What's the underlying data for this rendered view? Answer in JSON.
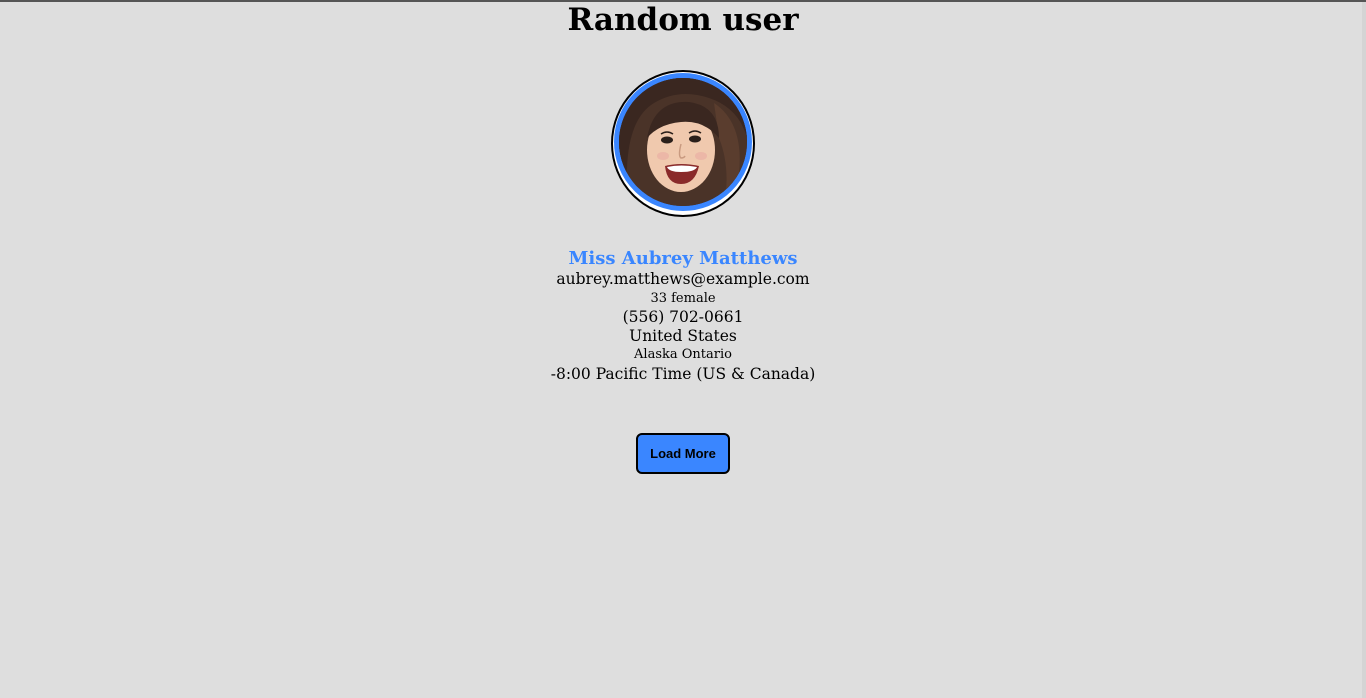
{
  "header": {
    "title": "Random user"
  },
  "user": {
    "name": "Miss Aubrey Matthews",
    "email": "aubrey.matthews@example.com",
    "age_gender": "33 female",
    "phone": "(556) 702-0661",
    "country": "United States",
    "region": "Alaska Ontario",
    "timezone": "-8:00 Pacific Time (US & Canada)"
  },
  "actions": {
    "load_more_label": "Load More"
  },
  "colors": {
    "accent": "#3a86ff",
    "background": "#dedede"
  }
}
